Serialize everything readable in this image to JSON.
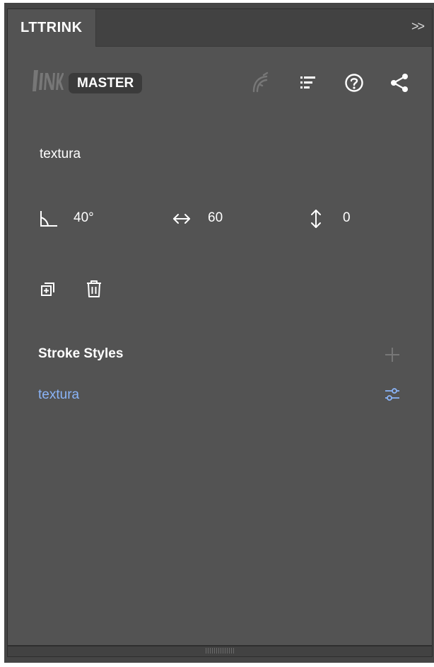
{
  "panel": {
    "tab_label": "LTTRINK",
    "collapse_glyph": ">>",
    "icons": {
      "collapse": "double-chevron-right-icon",
      "logo": "ink-logo",
      "pen": "pen-nib-icon",
      "list": "list-sort-icon",
      "help": "help-circle-icon",
      "share": "share-icon",
      "angle": "angle-icon",
      "width": "horizontal-arrows-icon",
      "height": "vertical-arrows-icon",
      "duplicate": "duplicate-icon",
      "trash": "trash-icon",
      "add": "plus-icon",
      "settings": "sliders-icon"
    }
  },
  "toolbar": {
    "badge": "MASTER"
  },
  "style": {
    "name": "textura",
    "angle": "40°",
    "width": "60",
    "height": "0"
  },
  "stroke_styles": {
    "title": "Stroke Styles",
    "items": [
      {
        "label": "textura"
      }
    ]
  },
  "colors": {
    "panel_bg": "#535353",
    "tabbar_bg": "#424242",
    "accent_link": "#8ab4f8",
    "badge_bg": "#3b3b3b"
  }
}
